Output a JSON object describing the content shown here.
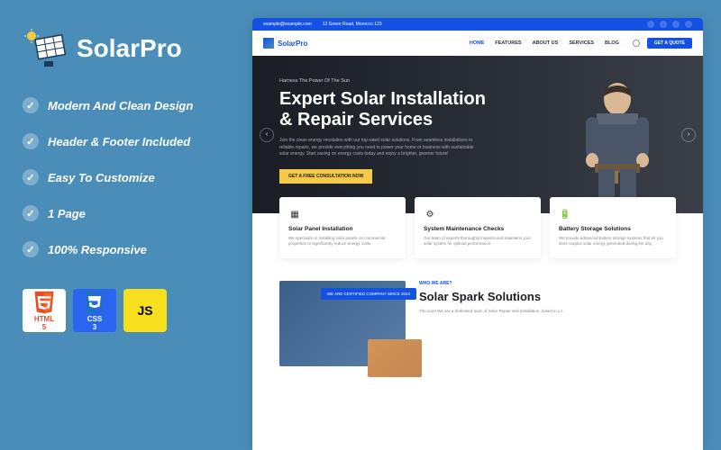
{
  "brand": {
    "name": "SolarPro"
  },
  "features": [
    "Modern And Clean Design",
    "Header & Footer Included",
    "Easy To Customize",
    "1 Page",
    "100% Responsive"
  ],
  "tech": {
    "html": "HTML",
    "css": "CSS",
    "js": "JS"
  },
  "mockup": {
    "topbar": {
      "email": "example@example.com",
      "address": "12 Green Road, Morocco 123"
    },
    "nav": {
      "brand": "SolarPro",
      "items": [
        "HOME",
        "FEATURES",
        "ABOUT US",
        "SERVICES",
        "BLOG"
      ],
      "quote": "GET A QUOTE"
    },
    "hero": {
      "eyebrow": "Harness The Power Of The Sun",
      "title": "Expert Solar Installation & Repair Services",
      "desc": "Join the clean energy revolution with our top-rated solar solutions. From seamless installations to reliable repairs, we provide everything you need to power your home or business with sustainable solar energy. Start saving on energy costs today and enjoy a brighter, greener future!",
      "cta": "GET A FREE CONSULTATION NOW"
    },
    "cards": [
      {
        "title": "Solar Panel Installation",
        "desc": "We specialize in installing solar panels on commercial properties to significantly reduce energy costs."
      },
      {
        "title": "System Maintenance Checks",
        "desc": "Our team of experts thoroughly inspects and maintains your solar system for optimal performance."
      },
      {
        "title": "Battery Storage Solutions",
        "desc": "We provide advanced battery storage systems that let you store surplus solar energy generated during the day."
      }
    ],
    "about": {
      "badge": "WE ARE CERTIFIED COMPANY SINCE 2024",
      "eyebrow": "WHO WE ARE?",
      "title": "Solar Spark Solutions",
      "desc": "The core! We are a dedicated team of Solar Repair and Installation, based in LA"
    }
  }
}
